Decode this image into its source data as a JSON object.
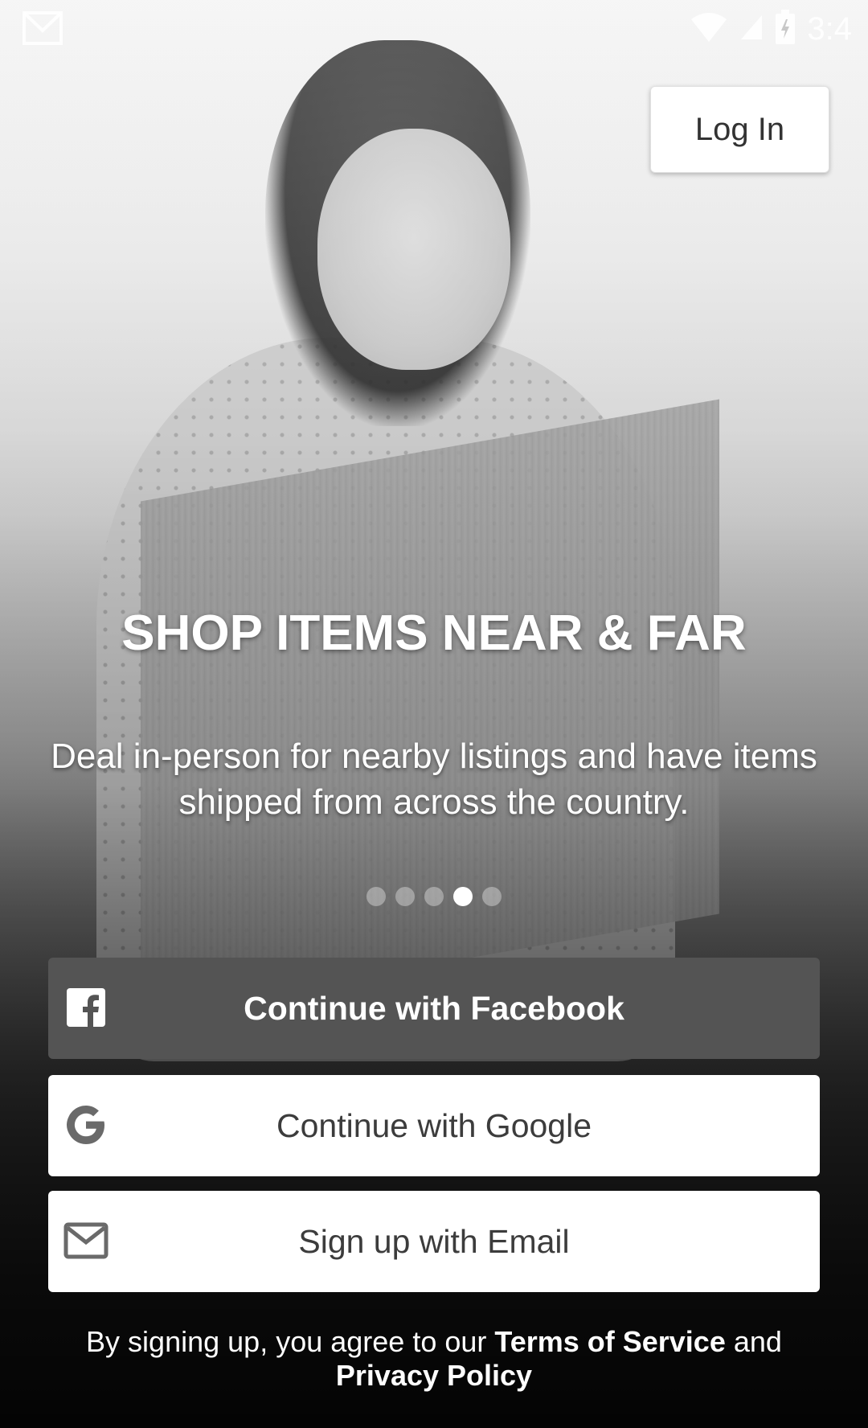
{
  "status_bar": {
    "notification_icon": "gmail-icon",
    "wifi_icon": "wifi-icon",
    "signal_icon": "signal-icon",
    "battery_icon": "battery-charging-icon",
    "time": "3:4"
  },
  "header": {
    "login_label": "Log In"
  },
  "carousel": {
    "title": "SHOP ITEMS NEAR & FAR",
    "description": "Deal in-person for nearby listings and have items shipped from across the country.",
    "page_count": 5,
    "active_page": 4
  },
  "auth": {
    "facebook_label": "Continue with Facebook",
    "facebook_icon": "facebook-icon",
    "google_label": "Continue with Google",
    "google_icon": "google-icon",
    "email_label": "Sign up with Email",
    "email_icon": "email-icon"
  },
  "legal": {
    "prefix": "By signing up, you agree to our ",
    "terms_link": "Terms of Service",
    "connector": " and ",
    "privacy_link": "Privacy Policy"
  },
  "colors": {
    "facebook_button_bg": "#545454",
    "button_white": "#ffffff",
    "text_dark": "#3c3c3c"
  }
}
